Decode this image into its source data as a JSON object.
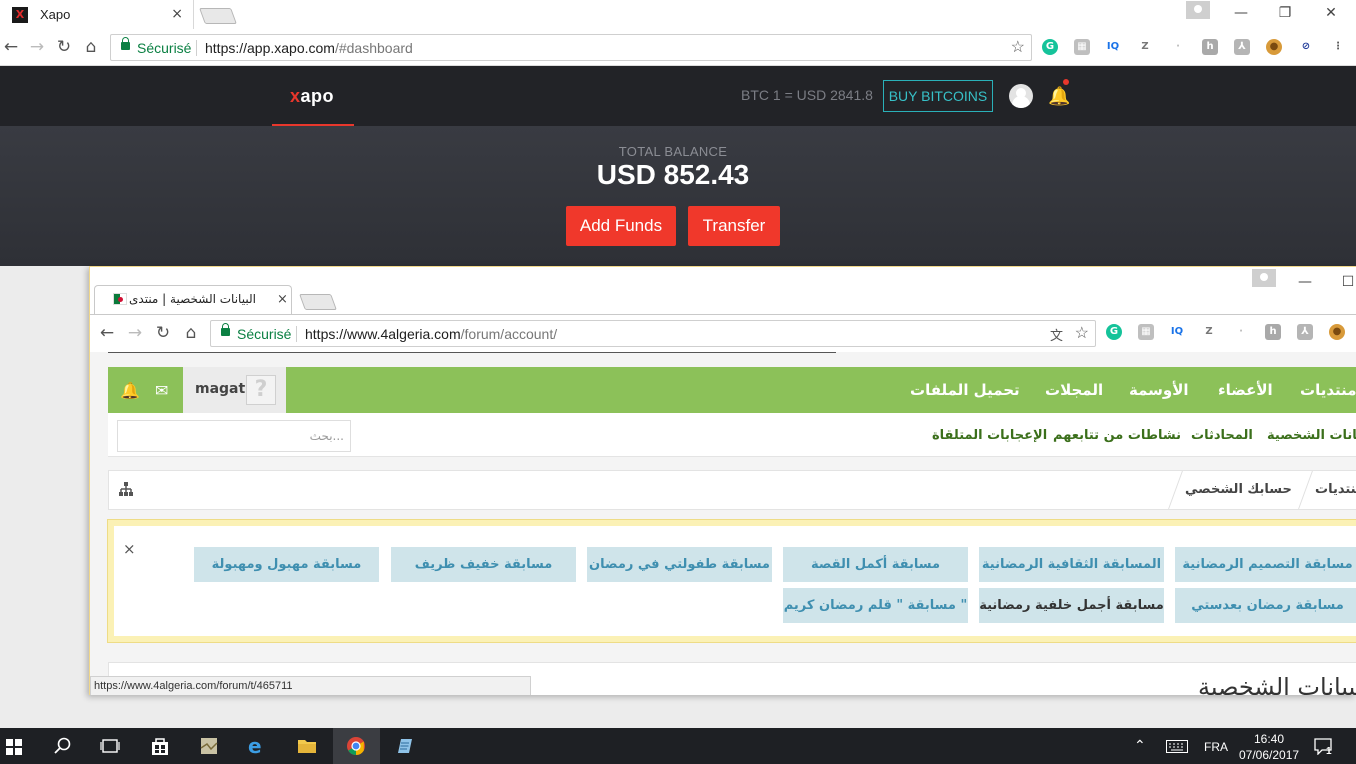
{
  "back_window": {
    "tab_title": "Xapo",
    "favicon_letter": "X",
    "tab_close": "×",
    "secure_label": "Sécurisé",
    "url_host": "https://app.xapo.com",
    "url_rest": "/#dashboard",
    "window_controls": {
      "minimize": "—",
      "maximize": "❐",
      "close": "✕"
    },
    "extensions": [
      "G",
      "▦",
      "IQ",
      "Z",
      "·",
      "h",
      "⅄",
      "●",
      "⊘",
      "⋮"
    ],
    "header": {
      "logo_prefix": "x",
      "logo_rest": "apo",
      "btc_rate": "BTC 1 = USD 2841.8",
      "buy_button": "BUY BITCOINS"
    },
    "balance": {
      "label": "TOTAL BALANCE",
      "value": "USD 852.43",
      "add_funds": "Add Funds",
      "transfer": "Transfer"
    }
  },
  "front_window": {
    "tab_title": "البيانات الشخصية | منتدى",
    "tab_close": "×",
    "secure_label": "Sécurisé",
    "url_host": "https://www.4algeria.com",
    "url_rest": "/forum/account/",
    "window_controls": {
      "minimize": "—",
      "maximize": "☐"
    },
    "extensions": [
      "G",
      "▦",
      "IQ",
      "Z",
      "·",
      "h",
      "⅄",
      "●"
    ],
    "nav": {
      "items": [
        "منتديات",
        "الأعضاء",
        "الأوسمة",
        "المجلات",
        "تحميل الملفات"
      ],
      "username": "magat",
      "avatar_glyph": "?"
    },
    "subnav": {
      "search_placeholder": "بحث...",
      "items": [
        "البيانات الشخصية",
        "المحادثات",
        "نشاطات من تتابعهم",
        "الإعجابات المتلقاة"
      ]
    },
    "breadcrumbs": [
      "منتديات",
      "حسابك الشخصي"
    ],
    "notice": {
      "close": "×",
      "competitions_row1": [
        "مسابقة التصميم الرمضانية",
        "المسابقة الثقافية الرمضانية",
        "مسابقة أكمل القصة",
        "مسابقة طفولتي في رمضان",
        "مسابقة خفيف ظريف",
        "مسابقة مهبول ومهبولة"
      ],
      "competitions_row2": [
        "مسابقة رمضان بعدستي",
        "مسابقة أجمل خلفية رمضانية",
        "مسابقة \" قلم رمضان كريم \""
      ]
    },
    "page_heading": "البيانات الشخصية",
    "status_url": "https://www.4algeria.com/forum/t/465711"
  },
  "taskbar": {
    "language": "FRA",
    "time": "16:40",
    "date": "07/06/2017",
    "notification_count": "1"
  },
  "colors": {
    "xapo_red": "#f0382b",
    "xapo_teal": "#37c0c7",
    "forum_green": "#8cc159",
    "competition_bg": "#cfe4ea"
  }
}
